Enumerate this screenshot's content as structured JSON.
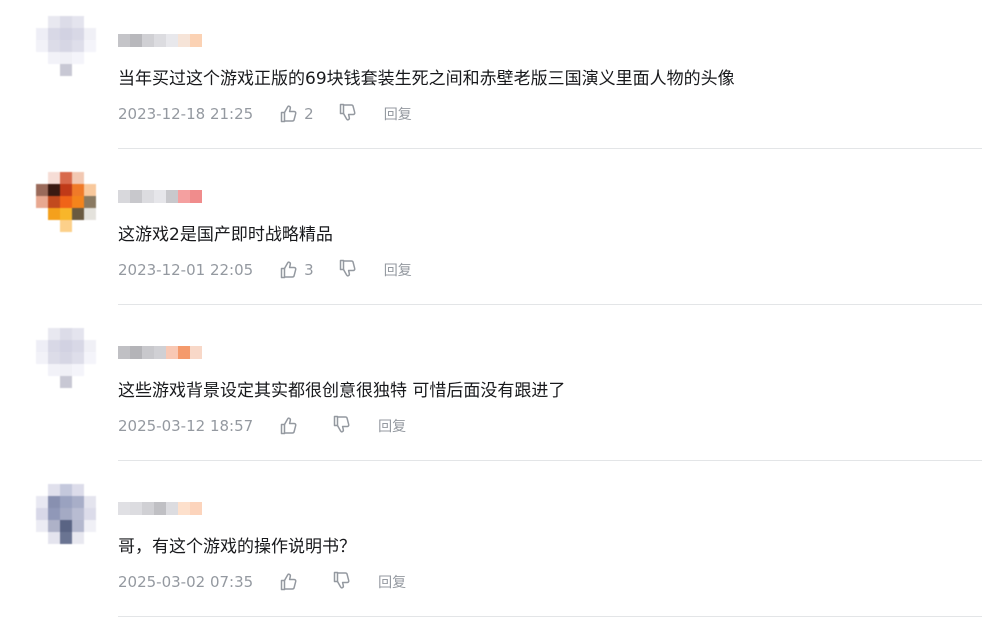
{
  "comments": [
    {
      "text": "当年买过这个游戏正版的69块钱套装生死之间和赤壁老版三国演义里面人物的头像",
      "time": "2023-12-18 21:25",
      "likes": "2",
      "reply_label": "回复",
      "avatar_colors": [
        "#ffffff",
        "#e8e8f0",
        "#dcdce8",
        "#e4e4ee",
        "#ffffff",
        "#eeeef6",
        "#d8d8e6",
        "#d2d2e2",
        "#d8d8e6",
        "#f0f0f6",
        "#f2f2f8",
        "#dcdce8",
        "#d6d6e4",
        "#dedeea",
        "#f4f4fa",
        "#ffffff",
        "#f2f2f8",
        "#f0f0f6",
        "#f4f4fa",
        "#ffffff",
        "#ffffff",
        "#ffffff",
        "#c8c8d4",
        "#ffffff",
        "#ffffff"
      ],
      "name_colors": [
        "#c4c4c8",
        "#b8b8bc",
        "#d0d0d4",
        "#dcdce0",
        "#e8e8ec",
        "#f6e4d8",
        "#fbd2b4"
      ]
    },
    {
      "text": "这游戏2是国产即时战略精品",
      "time": "2023-12-01 22:05",
      "likes": "3",
      "reply_label": "回复",
      "avatar_colors": [
        "#ffffff",
        "#f6ddd6",
        "#d86a4c",
        "#f2c8b2",
        "#ffffff",
        "#9a6a5a",
        "#3a1a12",
        "#c03a18",
        "#f07a28",
        "#f8c89c",
        "#e8a890",
        "#c24a1e",
        "#f06418",
        "#f4841c",
        "#8a7a62",
        "#ffffff",
        "#f4a01c",
        "#f8b62a",
        "#6a5a40",
        "#e4e2dc",
        "#ffffff",
        "#ffffff",
        "#fcd08a",
        "#ffffff",
        "#ffffff"
      ],
      "name_colors": [
        "#d8d8dc",
        "#c8c8cc",
        "#dcdce0",
        "#e6e6ea",
        "#c8c8cc",
        "#f4a0a0",
        "#f08c8c"
      ]
    },
    {
      "text": "这些游戏背景设定其实都很创意很独特 可惜后面没有跟进了",
      "time": "2025-03-12 18:57",
      "likes": "",
      "reply_label": "回复",
      "avatar_colors": [
        "#ffffff",
        "#e8e8f0",
        "#dcdce8",
        "#e4e4ee",
        "#ffffff",
        "#eeeef6",
        "#d8d8e6",
        "#d2d2e2",
        "#d8d8e6",
        "#f0f0f6",
        "#f2f2f8",
        "#dcdce8",
        "#d6d6e4",
        "#dedeea",
        "#f4f4fa",
        "#ffffff",
        "#f2f2f8",
        "#f0f0f6",
        "#f4f4fa",
        "#ffffff",
        "#ffffff",
        "#ffffff",
        "#c8c8d4",
        "#ffffff",
        "#ffffff"
      ],
      "name_colors": [
        "#c0c0c4",
        "#b4b4b8",
        "#c8c8cc",
        "#d0d0d4",
        "#f8c8b4",
        "#f49a6c",
        "#f8d8c8"
      ]
    },
    {
      "text": "哥，有这个游戏的操作说明书？",
      "time": "2025-03-02 07:35",
      "likes": "",
      "reply_label": "回复",
      "avatar_colors": [
        "#ffffff",
        "#e0e0ec",
        "#c4c8dc",
        "#dcdcea",
        "#ffffff",
        "#e8e8f2",
        "#8890b0",
        "#9aa2c0",
        "#a8aec8",
        "#e4e4ee",
        "#d8d8e8",
        "#9098b8",
        "#a4aac4",
        "#b8bcd2",
        "#dcdcea",
        "#ececf4",
        "#aeb2c8",
        "#5a6484",
        "#b4b8ce",
        "#f0f0f6",
        "#ffffff",
        "#e4e4ee",
        "#6a7492",
        "#e8e8f0",
        "#ffffff"
      ],
      "name_colors": [
        "#e0e0e4",
        "#dcdce0",
        "#d0d0d4",
        "#c0c0c4",
        "#dcdce0",
        "#fde0cc",
        "#fcd4bc"
      ]
    }
  ]
}
